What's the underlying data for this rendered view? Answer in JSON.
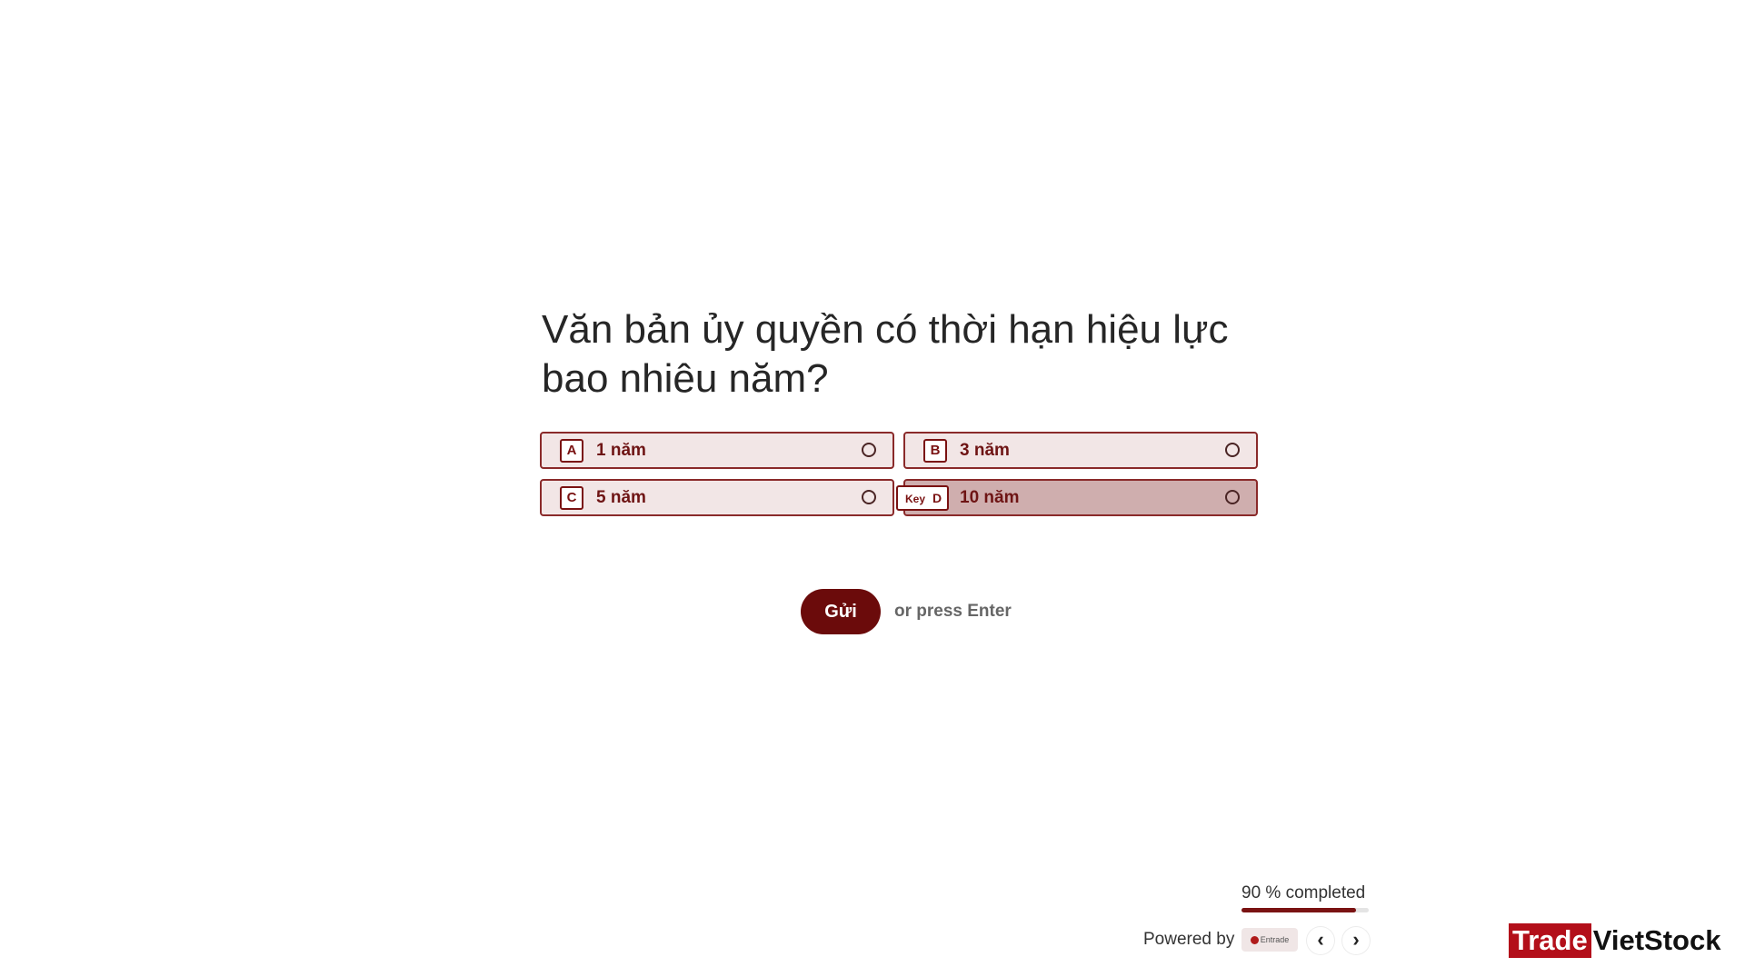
{
  "question": {
    "text": "Văn bản ủy quyền có thời hạn hiệu lực bao nhiêu năm?"
  },
  "options": [
    {
      "key": "A",
      "label": "1 năm",
      "selected": false
    },
    {
      "key": "B",
      "label": "3 năm",
      "selected": false
    },
    {
      "key": "C",
      "label": "5 năm",
      "selected": false
    },
    {
      "key": "D",
      "label": "10 năm",
      "selected": true,
      "hint": "Key"
    }
  ],
  "submit": {
    "label": "Gửi",
    "hint": "or press Enter"
  },
  "progress": {
    "label": "90 % completed",
    "percent": 90
  },
  "footer": {
    "powered_by": "Powered by",
    "brand": "Entrade",
    "prev_icon": "chevron-left-icon",
    "next_icon": "chevron-right-icon"
  },
  "watermark": {
    "part1": "Trade",
    "part2": "VietStock"
  },
  "colors": {
    "accent": "#6b0b0b",
    "option_bg": "#f2e6e6",
    "option_selected_bg": "#cfaeae",
    "option_border": "#8a2a2a"
  }
}
